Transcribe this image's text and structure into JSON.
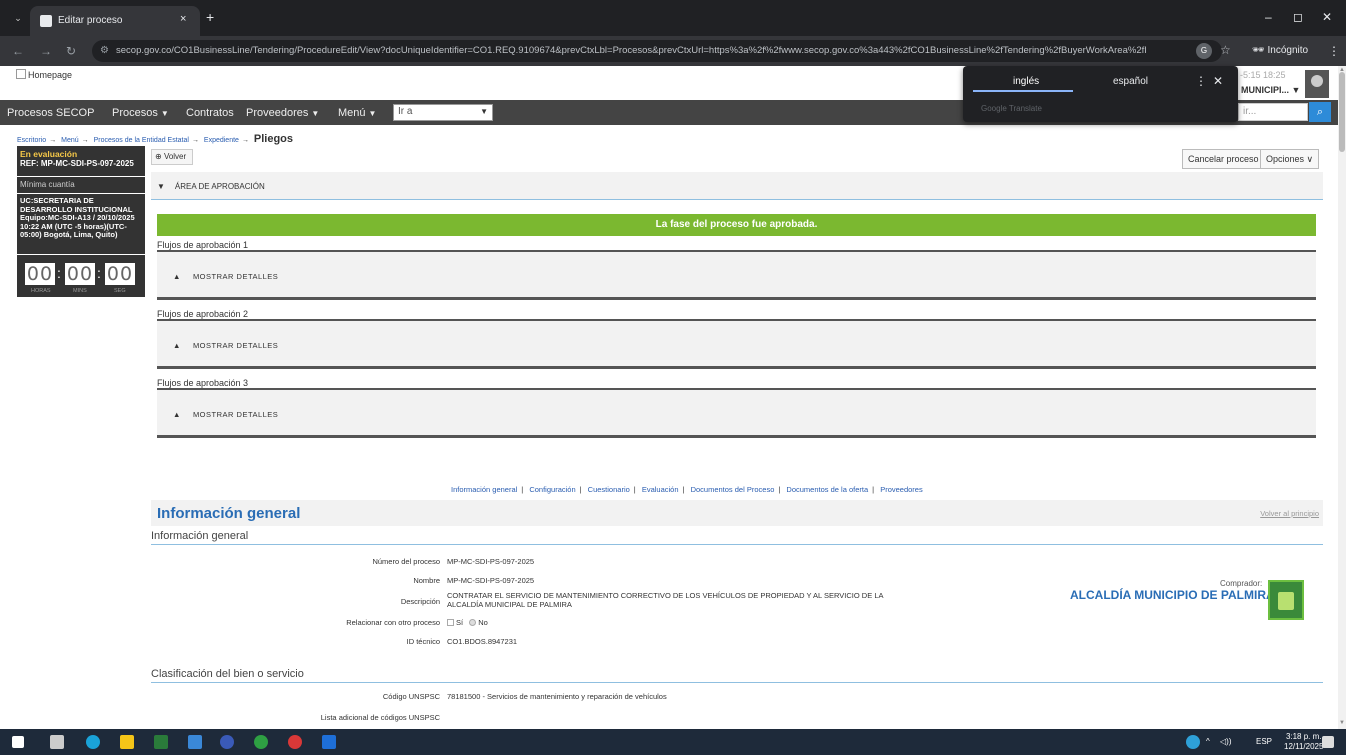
{
  "browser": {
    "tab_title": "Editar proceso",
    "tab_close": "×",
    "new_tab": "+",
    "url": "secop.gov.co/CO1BusinessLine/Tendering/ProcedureEdit/View?docUniqueIdentifier=CO1.REQ.9109674&prevCtxLbl=Procesos&prevCtxUrl=https%3a%2f%2fwww.secop.gov.co%3a443%2fCO1BusinessLine%2fTendering%2fBuyerWorkArea%2fIndex%...",
    "incognito_label": "Incógnito",
    "window_min": "–",
    "window_max": "◻",
    "window_close": "✕"
  },
  "translate_popup": {
    "lang_en": "inglés",
    "lang_es": "español",
    "brand": "Google Translate",
    "more": "⋮",
    "close": "✕"
  },
  "header": {
    "homepage_alt": "Homepage",
    "user_date": "-5:15 18:25",
    "user_name": "MUNICIPI..."
  },
  "menubar": {
    "items": [
      {
        "label": "Procesos SECOP"
      },
      {
        "label": "Procesos"
      },
      {
        "label": "Contratos"
      },
      {
        "label": "Proveedores"
      },
      {
        "label": "Menú"
      }
    ],
    "goto_placeholder": "Ir a",
    "search_placeholder": "ir..."
  },
  "breadcrumb": {
    "items": [
      "Escritorio",
      "Menú",
      "Procesos de la Entidad Estatal",
      "Expediente"
    ],
    "current": "Pliegos"
  },
  "sidebar": {
    "status": "En evaluación",
    "ref": "REF: MP-MC-SDI-PS-097-2025",
    "type": "Mínima cuantía",
    "info": "UC:SECRETARIA DE DESARROLLO INSTITUCIONAL Equipo:MC-SDI-A13 / 20/10/2025 10:22 AM (UTC -5 horas)(UTC-05:00) Bogotá, Lima, Quito)",
    "timer": {
      "h": "00",
      "m": "00",
      "s": "00",
      "h_label": "HORAS",
      "m_label": "MINS",
      "s_label": "SEG"
    }
  },
  "actions": {
    "volver": "Volver",
    "cancelar": "Cancelar proceso",
    "opciones": "Opciones"
  },
  "approval": {
    "area_label": "ÁREA DE APROBACIÓN",
    "green_msg": "La fase del proceso fue aprobada.",
    "flows": [
      {
        "label": "Flujos de aprobación 1",
        "details": "MOSTRAR DETALLES"
      },
      {
        "label": "Flujos de aprobación 2",
        "details": "MOSTRAR DETALLES"
      },
      {
        "label": "Flujos de aprobación 3",
        "details": "MOSTRAR DETALLES"
      }
    ]
  },
  "section_links": [
    "Información general",
    "Configuración",
    "Cuestionario",
    "Evaluación",
    "Documentos del Proceso",
    "Documentos de la oferta",
    "Proveedores"
  ],
  "info_general": {
    "title": "Información general",
    "back_top": "Volver al principio",
    "subheader": "Información general",
    "fields": {
      "numero_label": "Número del proceso",
      "numero_value": "MP-MC-SDI-PS-097-2025",
      "nombre_label": "Nombre",
      "nombre_value": "MP-MC-SDI-PS-097-2025",
      "descripcion_label": "Descripción",
      "descripcion_value_1": "CONTRATAR EL SERVICIO DE MANTENIMIENTO CORRECTIVO DE LOS VEHÍCULOS DE PROPIEDAD Y AL SERVICIO DE LA",
      "descripcion_value_2": "ALCALDÍA MUNICIPAL DE PALMIRA",
      "relacionar_label": "Relacionar con otro proceso",
      "si": "Sí",
      "no": "No",
      "id_label": "ID técnico",
      "id_value": "CO1.BDOS.8947231"
    },
    "comprador_label": "Comprador:",
    "comprador_name": "ALCALDÍA MUNICIPIO DE PALMIRA"
  },
  "clasificacion": {
    "title": "Clasificación del bien o servicio",
    "unspsc_label": "Código UNSPSC",
    "unspsc_value": "78181500 - Servicios de mantenimiento y reparación de vehículos",
    "adicional_label": "Lista adicional de códigos UNSPSC"
  },
  "taskbar": {
    "time": "3:18 p. m.",
    "date": "12/11/2025",
    "lang": "ESP"
  }
}
